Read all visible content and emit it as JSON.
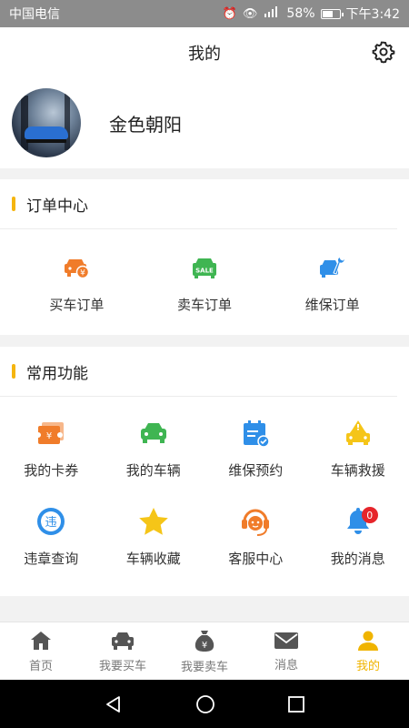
{
  "status_bar": {
    "carrier": "中国电信",
    "battery_percent": "58%",
    "time": "下午3:42",
    "icons": [
      "alarm-icon",
      "eye-icon",
      "4g-signal-icon",
      "battery-icon"
    ]
  },
  "header": {
    "title": "我的",
    "settings_icon": "gear-icon"
  },
  "profile": {
    "username": "金色朝阳"
  },
  "orders": {
    "title": "订单中心",
    "items": [
      {
        "label": "买车订单",
        "icon": "buy-car-order-icon",
        "color": "#f07c2a"
      },
      {
        "label": "卖车订单",
        "icon": "sell-car-order-icon",
        "color": "#3fb552",
        "icon_text": "SALE"
      },
      {
        "label": "维保订单",
        "icon": "maintenance-order-icon",
        "color": "#2f8fe8"
      }
    ]
  },
  "functions": {
    "title": "常用功能",
    "items": [
      {
        "label": "我的卡券",
        "icon": "coupon-icon",
        "color": "#f07c2a"
      },
      {
        "label": "我的车辆",
        "icon": "my-car-icon",
        "color": "#3fb552"
      },
      {
        "label": "维保预约",
        "icon": "calendar-check-icon",
        "color": "#2f8fe8"
      },
      {
        "label": "车辆救援",
        "icon": "rescue-warning-icon",
        "color": "#f5c518"
      },
      {
        "label": "违章查询",
        "icon": "violation-query-icon",
        "color": "#2f8fe8",
        "icon_text": "违"
      },
      {
        "label": "车辆收藏",
        "icon": "star-icon",
        "color": "#f5c518"
      },
      {
        "label": "客服中心",
        "icon": "customer-service-icon",
        "color": "#f07c2a"
      },
      {
        "label": "我的消息",
        "icon": "bell-icon",
        "color": "#2f8fe8",
        "badge": "0"
      }
    ]
  },
  "tabbar": {
    "active_color": "#f0b400",
    "items": [
      {
        "label": "首页",
        "icon": "home-icon"
      },
      {
        "label": "我要买车",
        "icon": "car-icon"
      },
      {
        "label": "我要卖车",
        "icon": "money-bag-icon",
        "icon_text": "¥"
      },
      {
        "label": "消息",
        "icon": "mail-icon"
      },
      {
        "label": "我的",
        "icon": "user-icon",
        "active": true
      }
    ]
  },
  "system_nav": [
    "back-icon",
    "home-circle-icon",
    "recents-icon"
  ]
}
